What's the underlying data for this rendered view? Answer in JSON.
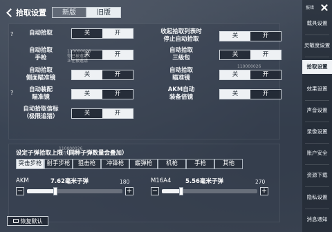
{
  "header": {
    "title": "拾取设置",
    "tabs": [
      "新版",
      "旧版"
    ],
    "active_tab": 1
  },
  "settings": [
    {
      "label": "自动拾取",
      "left": "关",
      "right": "开",
      "selected": "right",
      "help": "?"
    },
    {
      "label": "收起拾取列表时\n停止自动拾取",
      "left": "关",
      "right": "开",
      "selected": "left"
    },
    {
      "label": "自动拾取\n手枪",
      "left": "关",
      "right": "开",
      "selected": "right"
    },
    {
      "label": "自动拾取\n三级包",
      "left": "关",
      "right": "开",
      "selected": "right"
    },
    {
      "label": "自动拾取\n侧面瞄准镜",
      "left": "关",
      "right": "开",
      "selected": "left"
    },
    {
      "label": "自动拾取\n瞄准镜",
      "left": "关",
      "right": "开",
      "selected": "left"
    },
    {
      "label": "自动装配\n瞄准镜",
      "left": "关",
      "right": "开",
      "selected": "left",
      "help": "?"
    },
    {
      "label": "AKM自动\n装备倍镜",
      "left": "关",
      "right": "开",
      "selected": "left"
    },
    {
      "label": "自动拾取信标\n（极限追猎）",
      "left": "关",
      "right": "开",
      "selected": "right"
    }
  ],
  "watermarks": [
    "110000026\n你已被邀请\n正在被邀请",
    "110000026",
    "110000026\n正在被邀请"
  ],
  "ammo": {
    "title": "设定子弹拾取上限（同种子弹数量会叠加）",
    "categories": [
      "突击步枪",
      "射手步枪",
      "狙击枪",
      "冲锋枪",
      "霰弹枪",
      "机枪",
      "手枪",
      "其他"
    ],
    "active_category": 0,
    "weapons": [
      {
        "name": "AKM",
        "ammo_label": "7.62毫米子弹",
        "max": "180",
        "fraction": 0.3
      },
      {
        "name": "M16A4",
        "ammo_label": "5.56毫米子弹",
        "max": "270",
        "fraction": 0.2
      }
    ]
  },
  "reset_label": "恢复默认",
  "sidebar": {
    "top_label": "报错",
    "items": [
      "载具设置",
      "灵敏度设置",
      "拾取设置",
      "效果设置",
      "声音设置",
      "录像设置",
      "账户安全",
      "资源下载",
      "隐私设置",
      "消息通知"
    ],
    "active": 2
  },
  "colors": {
    "toggle_selected": "#eef1f4",
    "toggle_unselected": "#1c2630",
    "sidebar_active": "#f0f3f6"
  }
}
